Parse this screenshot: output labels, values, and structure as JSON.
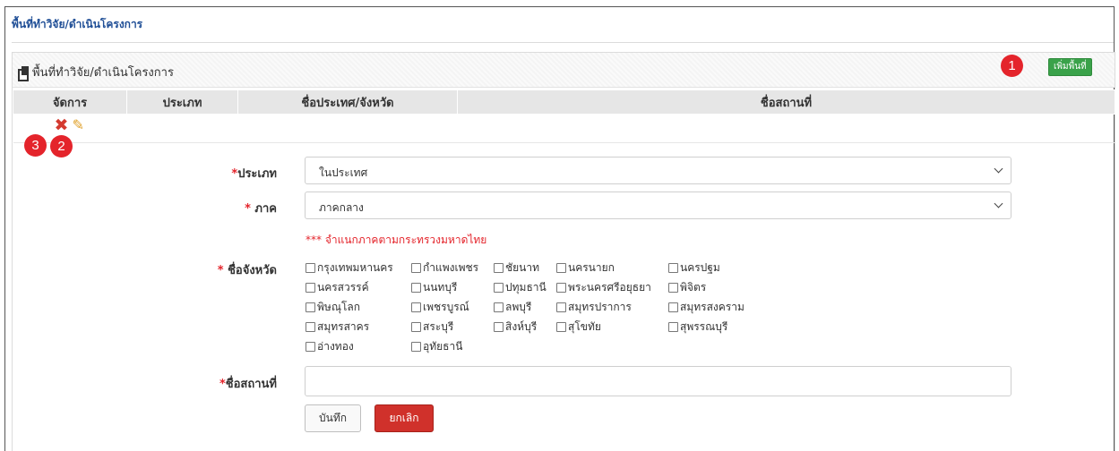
{
  "page": {
    "header": "พื้นที่ทำวิจัย/ดำเนินโครงการ"
  },
  "panel": {
    "title": "พื้นที่ทำวิจัย/ดำเนินโครงการ",
    "add_button": "เพิ่มพื้นที่"
  },
  "markers": [
    "1",
    "2",
    "3"
  ],
  "table": {
    "headers": [
      "จัดการ",
      "ประเภท",
      "ชื่อประเทศ/จังหวัด",
      "ชื่อสถานที่"
    ]
  },
  "icons": {
    "panel": "copy-icon",
    "delete": "delete-icon",
    "edit": "pencil-icon"
  },
  "form": {
    "type_label": "ประเภท",
    "type_value": "ในประเทศ",
    "region_label": " ภาค",
    "region_value": "ภาคกลาง",
    "region_note": "*** จำแนกภาคตามกระทรวงมหาดไทย",
    "province_label": " ชื่อจังหวัด",
    "provinces": [
      "กรุงเทพมหานคร",
      "กำแพงเพชร",
      "ชัยนาท",
      "นครนายก",
      "นครปฐม",
      "นครสวรรค์",
      "นนทบุรี",
      "ปทุมธานี",
      "พระนครศรีอยุธยา",
      "พิจิตร",
      "พิษณุโลก",
      "เพชรบูรณ์",
      "ลพบุรี",
      "สมุทรปราการ",
      "สมุทรสงคราม",
      "สมุทรสาคร",
      "สระบุรี",
      "สิงห์บุรี",
      "สุโขทัย",
      "สุพรรณบุรี",
      "อ่างทอง",
      "อุทัยธานี"
    ],
    "place_label": "ชื่อสถานที่",
    "required_mark": "*",
    "save_button": "บันทึก",
    "cancel_button": "ยกเลิก"
  },
  "colors": {
    "accent_red": "#e4242b",
    "add_green": "#3aa24a",
    "cancel_red": "#d0312b",
    "header_blue": "#1f4e96"
  }
}
